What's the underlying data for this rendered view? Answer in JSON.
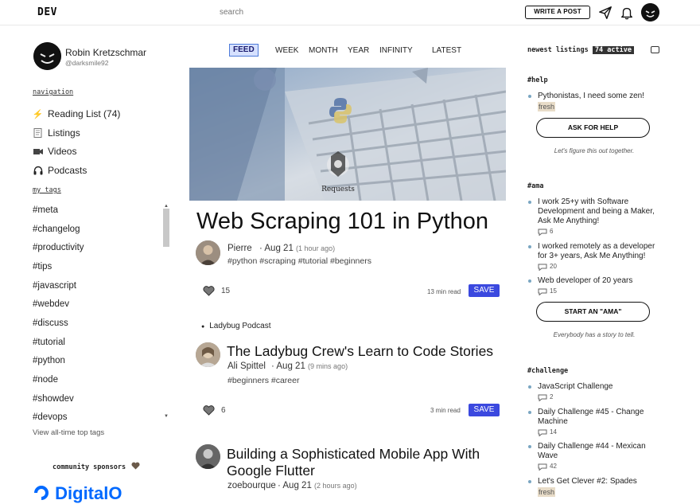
{
  "header": {
    "logo": "DEV",
    "search_placeholder": "search",
    "write_post_label": "WRITE A POST"
  },
  "profile": {
    "name": "Robin Kretzschmar",
    "handle": "@darksmile92"
  },
  "sidebar": {
    "navigation_heading": "navigation",
    "nav_items": [
      {
        "label": "Reading List (74)",
        "icon": "lightning-icon"
      },
      {
        "label": "Listings",
        "icon": "listings-icon"
      },
      {
        "label": "Videos",
        "icon": "video-camera-icon"
      },
      {
        "label": "Podcasts",
        "icon": "headphones-icon"
      }
    ],
    "tags_heading": "my_tags",
    "tags": [
      "#meta",
      "#changelog",
      "#productivity",
      "#tips",
      "#javascript",
      "#webdev",
      "#discuss",
      "#tutorial",
      "#python",
      "#node",
      "#showdev",
      "#devops"
    ],
    "view_all": "View all-time top tags",
    "sponsors_heading": "community sponsors",
    "sponsor_logo": "DigitalO"
  },
  "feed": {
    "tabs": [
      "FEED",
      "WEEK",
      "MONTH",
      "YEAR",
      "INFINITY",
      "LATEST"
    ],
    "active_tab": "FEED",
    "hero_caption": "Requests",
    "main_post": {
      "title": "Web Scraping 101 in Python",
      "author": "Pierre",
      "date": "Aug 21",
      "ago": "(1 hour ago)",
      "tags": "#python #scraping #tutorial #beginners",
      "reactions": "15",
      "read_time": "13 min read",
      "save_label": "SAVE"
    },
    "podcast_label": "Ladybug Podcast",
    "post2": {
      "title": "The Ladybug Crew's Learn to Code Stories",
      "author": "Ali Spittel",
      "date": "Aug 21",
      "ago": "(9 mins ago)",
      "tags": "#beginners #career",
      "reactions": "6",
      "read_time": "3 min read",
      "save_label": "SAVE"
    },
    "post3": {
      "title_line1": "Building a Sophisticated Mobile App With",
      "title_line2": "Google Flutter",
      "author": "zoebourque",
      "date": "Aug 21",
      "ago": "(2 hours ago)"
    }
  },
  "right": {
    "listings_heading": "newest listings",
    "active_badge": "74 active",
    "help_heading": "#help",
    "help_item": "Pythonistas, I need some zen!",
    "fresh_label": "fresh",
    "help_button": "ASK FOR HELP",
    "help_tagline": "Let's figure this out together.",
    "ama_heading": "#ama",
    "ama_items": [
      {
        "text": "I work 25+y with Software Development and being a Maker, Ask Me Anything!",
        "count": "6"
      },
      {
        "text": "I worked remotely as a developer for 3+ years, Ask Me Anything!",
        "count": "20"
      },
      {
        "text": "Web developer of 20 years",
        "count": "15"
      }
    ],
    "ama_button": "START AN \"AMA\"",
    "ama_tagline": "Everybody has a story to tell.",
    "challenge_heading": "#challenge",
    "challenge_items": [
      {
        "text": "JavaScript Challenge",
        "count": "2"
      },
      {
        "text": "Daily Challenge #45 - Change Machine",
        "count": "14"
      },
      {
        "text": "Daily Challenge #44 - Mexican Wave",
        "count": "42"
      },
      {
        "text": "Let's Get Clever #2: Spades",
        "count": ""
      }
    ],
    "colors": {
      "save": "#3b49df",
      "active_tab_bg": "#d6e1ff",
      "fresh_bg": "#e8dcc8"
    }
  }
}
